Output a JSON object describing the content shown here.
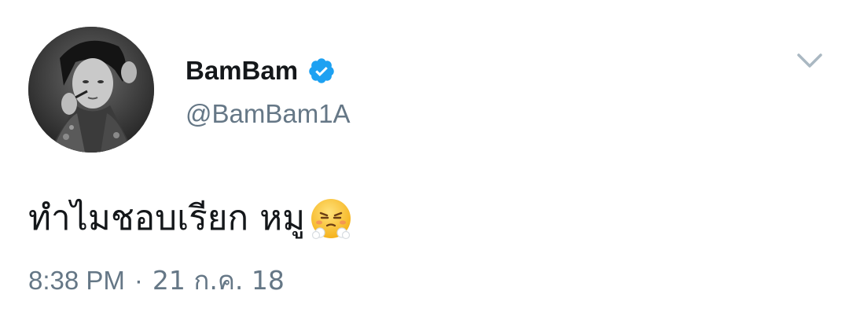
{
  "author": {
    "display_name": "BamBam",
    "handle": "@BamBam1A",
    "verified": true,
    "avatar_icon": "profile-photo-grayscale"
  },
  "tweet": {
    "text": "ทำไมชอบเรียก หมู",
    "emoji": "face-with-steam-from-nose"
  },
  "meta": {
    "time": "8:38 PM",
    "separator": "·",
    "date": "21 ก.ค. 18"
  },
  "icons": {
    "menu": "chevron-down-icon",
    "verified": "verified-badge-icon"
  },
  "colors": {
    "verified_blue": "#1da1f2",
    "secondary_text": "#657786",
    "primary_text": "#14171a",
    "chevron": "#aab8c2"
  }
}
